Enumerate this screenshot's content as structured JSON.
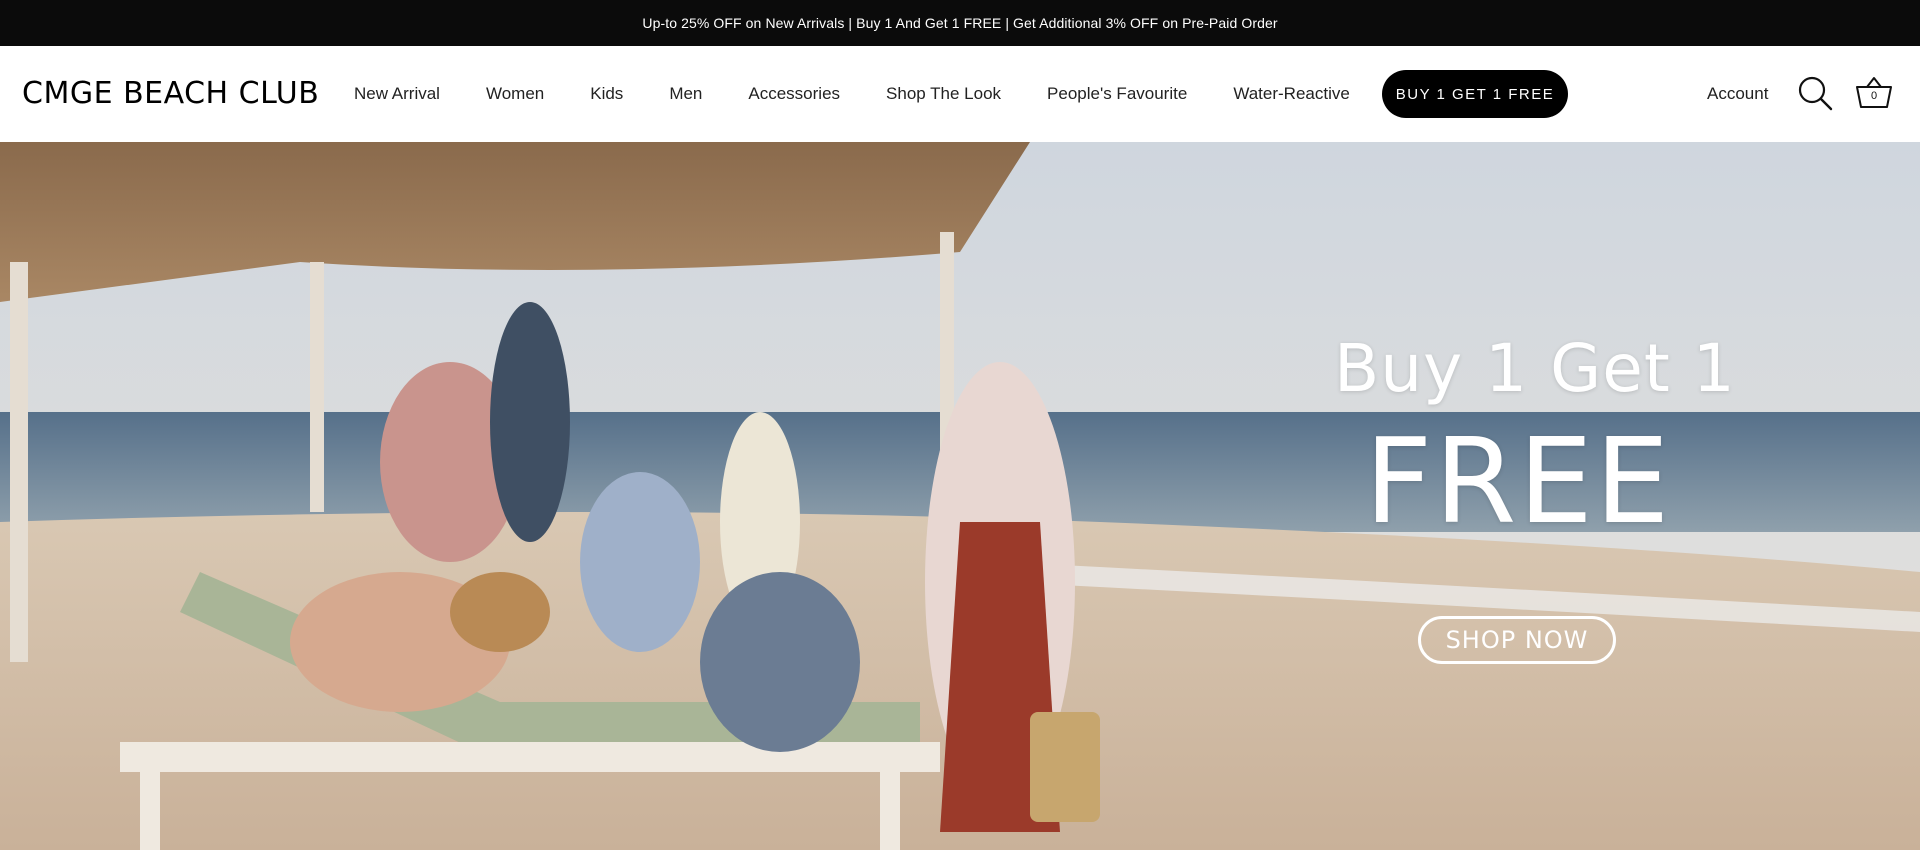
{
  "announcement": {
    "text": "Up-to 25% OFF on New Arrivals | Buy 1 And Get 1 FREE | Get Additional 3% OFF on Pre-Paid Order"
  },
  "header": {
    "logo": "CMGE BEACH CLUB",
    "nav": [
      {
        "label": "New Arrival"
      },
      {
        "label": "Women"
      },
      {
        "label": "Kids"
      },
      {
        "label": "Men"
      },
      {
        "label": "Accessories"
      },
      {
        "label": "Shop The Look"
      },
      {
        "label": "People's Favourite"
      },
      {
        "label": "Water-Reactive"
      }
    ],
    "promo_button": "BUY 1 GET 1 FREE",
    "account": "Account",
    "search_icon": "search-icon",
    "cart_icon": "basket-icon",
    "cart_count": "0"
  },
  "hero": {
    "line1": "Buy 1 Get 1",
    "line2": "FREE",
    "cta": "SHOP NOW"
  }
}
